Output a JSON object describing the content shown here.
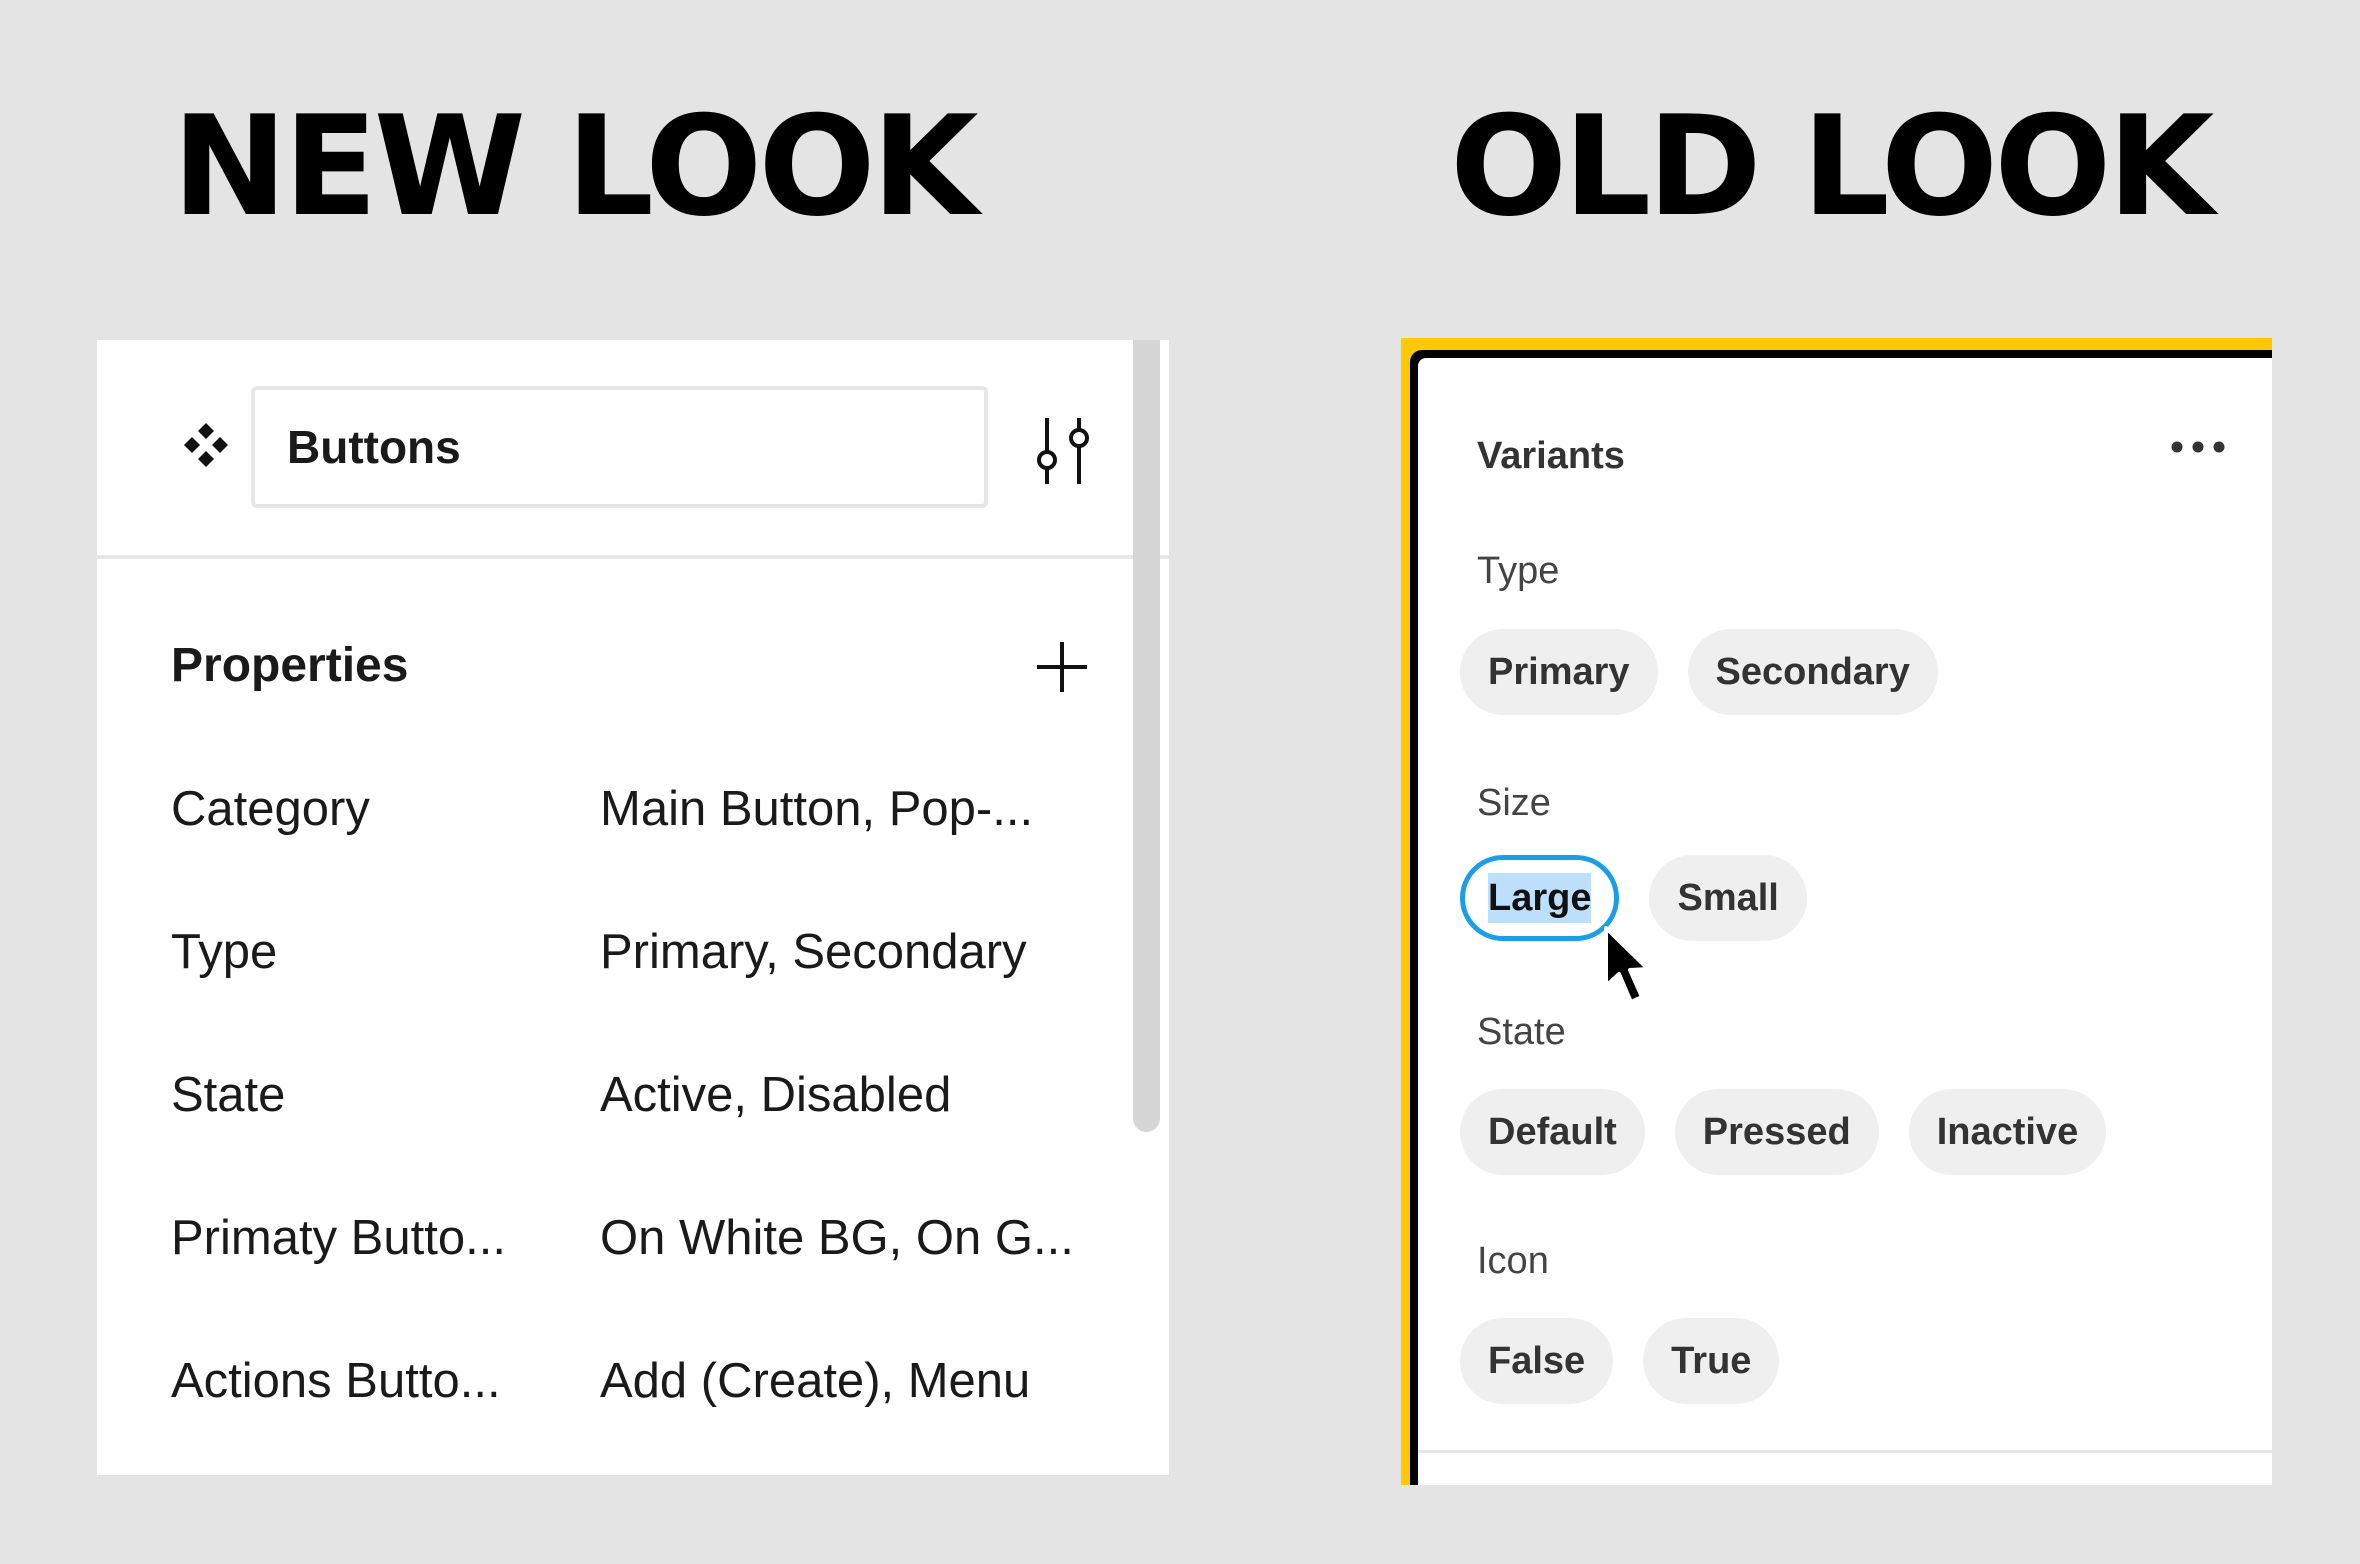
{
  "headings": {
    "new": "NEW LOOK",
    "old": "OLD LOOK"
  },
  "new_look": {
    "component_icon": "component-set-icon",
    "name_input_value": "Buttons",
    "adjust_icon": "adjust-sliders-icon",
    "properties_title": "Properties",
    "add_icon": "plus-icon",
    "properties": [
      {
        "label": "Category",
        "value": "Main Button, Pop-..."
      },
      {
        "label": "Type",
        "value": "Primary, Secondary"
      },
      {
        "label": "State",
        "value": "Active, Disabled"
      },
      {
        "label": "Primaty Butto...",
        "value": "On White BG, On G..."
      },
      {
        "label": "Actions Butto...",
        "value": "Add (Create), Menu"
      }
    ]
  },
  "old_look": {
    "title": "Variants",
    "more_icon": "more-horizontal-icon",
    "sections": [
      {
        "label": "Type",
        "options": [
          "Primary",
          "Secondary"
        ],
        "selected": null
      },
      {
        "label": "Size",
        "options": [
          "Large",
          "Small"
        ],
        "selected": "Large"
      },
      {
        "label": "State",
        "options": [
          "Default",
          "Pressed",
          "Inactive"
        ],
        "selected": null
      },
      {
        "label": "Icon",
        "options": [
          "False",
          "True"
        ],
        "selected": null
      }
    ],
    "frame_color": "#ffc800",
    "selection_color": "#1a9ee8",
    "text_highlight_color": "#bcdffb"
  },
  "cursor_icon": "arrow-cursor-icon"
}
